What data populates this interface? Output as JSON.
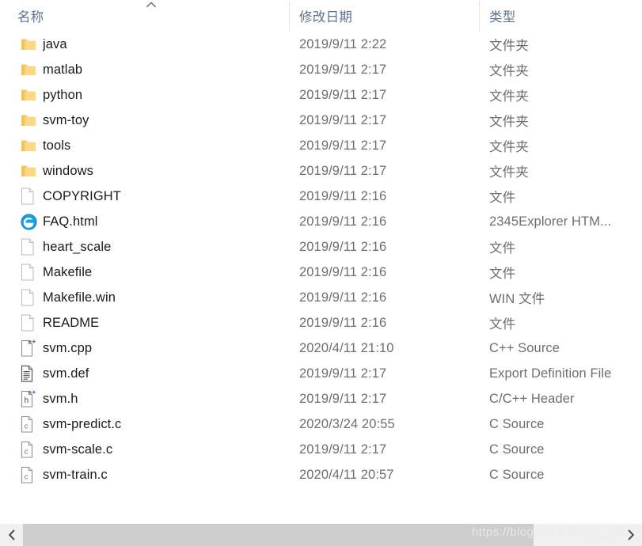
{
  "columns": {
    "name": {
      "label": "名称",
      "sort_icon": "chevron-up-icon",
      "sort_direction": "ascending"
    },
    "date": {
      "label": "修改日期"
    },
    "type": {
      "label": "类型"
    }
  },
  "files": [
    {
      "icon": "folder-icon",
      "name": "java",
      "date": "2019/9/11 2:22",
      "type": "文件夹"
    },
    {
      "icon": "folder-icon",
      "name": "matlab",
      "date": "2019/9/11 2:17",
      "type": "文件夹"
    },
    {
      "icon": "folder-icon",
      "name": "python",
      "date": "2019/9/11 2:17",
      "type": "文件夹"
    },
    {
      "icon": "folder-icon",
      "name": "svm-toy",
      "date": "2019/9/11 2:17",
      "type": "文件夹"
    },
    {
      "icon": "folder-icon",
      "name": "tools",
      "date": "2019/9/11 2:17",
      "type": "文件夹"
    },
    {
      "icon": "folder-icon",
      "name": "windows",
      "date": "2019/9/11 2:17",
      "type": "文件夹"
    },
    {
      "icon": "blank-file-icon",
      "name": "COPYRIGHT",
      "date": "2019/9/11 2:16",
      "type": "文件"
    },
    {
      "icon": "ie-browser-icon",
      "name": "FAQ.html",
      "date": "2019/9/11 2:16",
      "type": "2345Explorer HTM..."
    },
    {
      "icon": "blank-file-icon",
      "name": "heart_scale",
      "date": "2019/9/11 2:16",
      "type": "文件"
    },
    {
      "icon": "blank-file-icon",
      "name": "Makefile",
      "date": "2019/9/11 2:16",
      "type": "文件"
    },
    {
      "icon": "blank-file-icon",
      "name": "Makefile.win",
      "date": "2019/9/11 2:16",
      "type": "WIN 文件"
    },
    {
      "icon": "blank-file-icon",
      "name": "README",
      "date": "2019/9/11 2:16",
      "type": "文件"
    },
    {
      "icon": "cpp-source-icon",
      "name": "svm.cpp",
      "date": "2020/4/11 21:10",
      "type": "C++ Source"
    },
    {
      "icon": "def-file-icon",
      "name": "svm.def",
      "date": "2019/9/11 2:17",
      "type": "Export Definition File"
    },
    {
      "icon": "header-file-icon",
      "name": "svm.h",
      "date": "2019/9/11 2:17",
      "type": "C/C++ Header"
    },
    {
      "icon": "c-source-icon",
      "name": "svm-predict.c",
      "date": "2020/3/24 20:55",
      "type": "C Source"
    },
    {
      "icon": "c-source-icon",
      "name": "svm-scale.c",
      "date": "2019/9/11 2:17",
      "type": "C Source"
    },
    {
      "icon": "c-source-icon",
      "name": "svm-train.c",
      "date": "2020/4/11 20:57",
      "type": "C Source"
    }
  ],
  "scrollbar": {
    "left_arrow": "chevron-left-icon",
    "right_arrow": "chevron-right-icon"
  },
  "watermark": {
    "text": "https://blog.csdn.net/za_zhi"
  },
  "colors": {
    "header_text": "#5b7392",
    "name_text": "#1a1a1a",
    "meta_text": "#6e6e6e",
    "folder": "#fcd884",
    "folder_shade": "#f5c25b",
    "ie_blue": "#1ba1e2",
    "code_accent": "#9a4fa8",
    "scroll_thumb": "#cdcdcd",
    "scroll_track": "#f0f0f0",
    "divider": "#e3e3e3"
  }
}
